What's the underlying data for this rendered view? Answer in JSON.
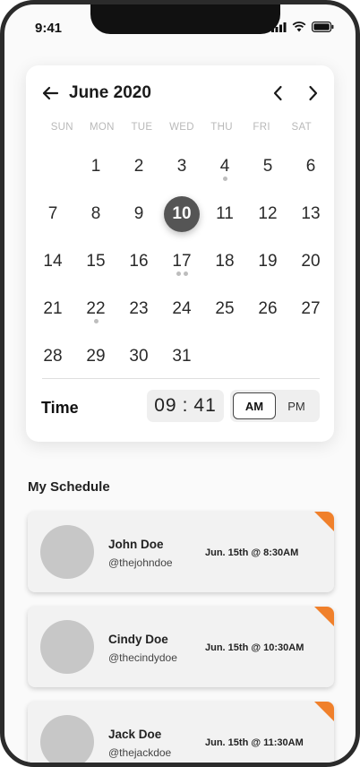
{
  "status_bar": {
    "time": "9:41"
  },
  "calendar": {
    "month_title": "June 2020",
    "weekdays": [
      "SUN",
      "MON",
      "TUE",
      "WED",
      "THU",
      "FRI",
      "SAT"
    ],
    "leading_blanks": 1,
    "selected_day": "10",
    "days": [
      {
        "n": "1",
        "dots": 0
      },
      {
        "n": "2",
        "dots": 0
      },
      {
        "n": "3",
        "dots": 0
      },
      {
        "n": "4",
        "dots": 1
      },
      {
        "n": "5",
        "dots": 0
      },
      {
        "n": "6",
        "dots": 0
      },
      {
        "n": "7",
        "dots": 0
      },
      {
        "n": "8",
        "dots": 0
      },
      {
        "n": "9",
        "dots": 0
      },
      {
        "n": "10",
        "dots": 0
      },
      {
        "n": "11",
        "dots": 0
      },
      {
        "n": "12",
        "dots": 0
      },
      {
        "n": "13",
        "dots": 0
      },
      {
        "n": "14",
        "dots": 0
      },
      {
        "n": "15",
        "dots": 0
      },
      {
        "n": "16",
        "dots": 0
      },
      {
        "n": "17",
        "dots": 2
      },
      {
        "n": "18",
        "dots": 0
      },
      {
        "n": "19",
        "dots": 0
      },
      {
        "n": "20",
        "dots": 0
      },
      {
        "n": "21",
        "dots": 0
      },
      {
        "n": "22",
        "dots": 1
      },
      {
        "n": "23",
        "dots": 0
      },
      {
        "n": "24",
        "dots": 0
      },
      {
        "n": "25",
        "dots": 0
      },
      {
        "n": "26",
        "dots": 0
      },
      {
        "n": "27",
        "dots": 0
      },
      {
        "n": "28",
        "dots": 0
      },
      {
        "n": "29",
        "dots": 0
      },
      {
        "n": "30",
        "dots": 0
      },
      {
        "n": "31",
        "dots": 0
      }
    ]
  },
  "time_picker": {
    "label": "Time",
    "hour": "09",
    "separator": ":",
    "minute": "41",
    "am_label": "AM",
    "pm_label": "PM",
    "selected_period": "AM"
  },
  "schedule": {
    "title": "My Schedule",
    "accent_color": "#f0802b",
    "items": [
      {
        "name": "John Doe",
        "handle": "@thejohndoe",
        "when": "Jun. 15th @ 8:30AM"
      },
      {
        "name": "Cindy Doe",
        "handle": "@thecindydoe",
        "when": "Jun. 15th @ 10:30AM"
      },
      {
        "name": "Jack Doe",
        "handle": "@thejackdoe",
        "when": "Jun. 15th @ 11:30AM"
      }
    ]
  }
}
